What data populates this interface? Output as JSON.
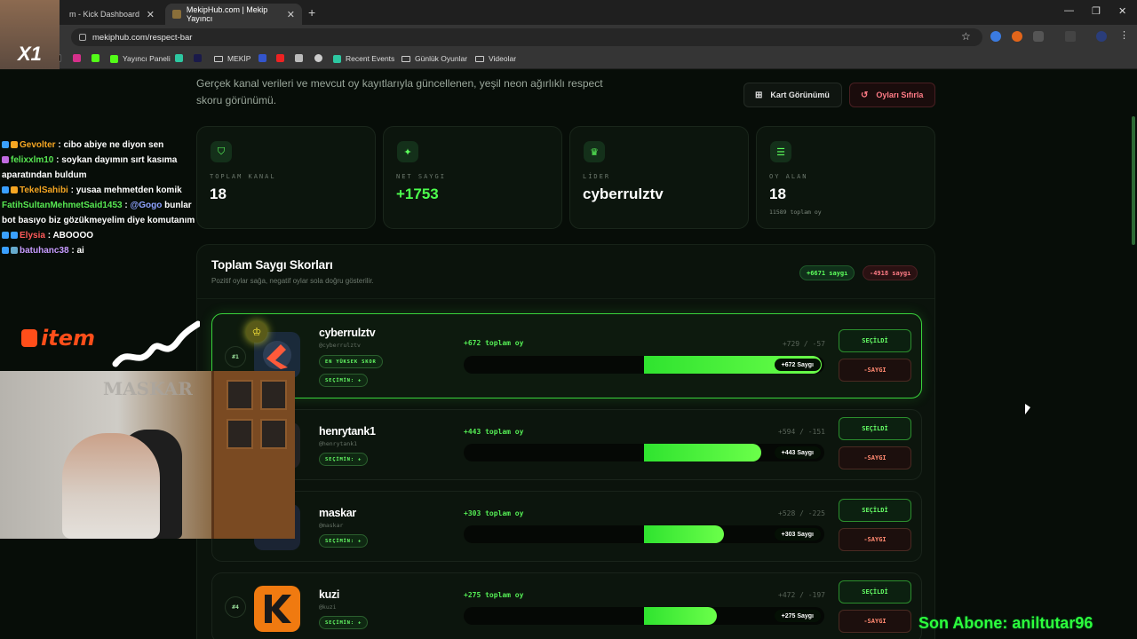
{
  "browser": {
    "tabs": [
      {
        "label": "m - Kick Dashboard"
      },
      {
        "label": "MekipHub.com | Mekip Yayıncı"
      }
    ],
    "url": "mekiphub.com/respect-bar",
    "bookmarks": [
      "Yayıncı Paneli",
      "MEKİP",
      "Recent Events",
      "Günlük Oyunlar",
      "Videolar"
    ]
  },
  "page": {
    "lede": "Gerçek kanal verileri ve mevcut oy kayıtlarıyla güncellenen, yeşil neon ağırlıklı respect skoru görünümü.",
    "card_view_label": "Kart Görünümü",
    "reset_label": "Oyları Sıfırla",
    "stats": [
      {
        "label": "TOPLAM KANAL",
        "value": "18",
        "icon": "shield-icon"
      },
      {
        "label": "NET SAYGI",
        "value": "+1753",
        "icon": "sparkle-icon"
      },
      {
        "label": "LİDER",
        "value": "cyberrulztv",
        "icon": "trophy-icon"
      },
      {
        "label": "OY ALAN",
        "value": "18",
        "sub": "11589 toplam oy",
        "icon": "list-icon"
      }
    ],
    "board": {
      "title": "Toplam Saygı Skorları",
      "subtitle": "Pozitif oylar sağa, negatif oylar sola doğru gösterilir.",
      "positive_chip": "+6671 saygı",
      "negative_chip": "-4918 saygı",
      "rows": [
        {
          "rank": "#1",
          "name": "cyberrulztv",
          "handle": "@cyberrulztv",
          "top_badge": "EN YÜKSEK SKOR",
          "select_badge": "SEÇİMİN: +",
          "total": "+672 toplam oy",
          "split": "+729 / -57",
          "score_label": "+672 Saygı",
          "score": 672,
          "up_label": "SEÇİLDİ",
          "down_label": "-SAYGI"
        },
        {
          "rank": "",
          "name": "henrytank1",
          "handle": "@henrytank1",
          "select_badge": "SEÇİMİN: +",
          "total": "+443 toplam oy",
          "split": "+594 / -151",
          "score_label": "+443 Saygı",
          "score": 443,
          "up_label": "SEÇİLDİ",
          "down_label": "-SAYGI"
        },
        {
          "rank": "",
          "name": "maskar",
          "handle": "@maskar",
          "select_badge": "SEÇİMİN: +",
          "total": "+303 toplam oy",
          "split": "+528 / -225",
          "score_label": "+303 Saygı",
          "score": 303,
          "up_label": "SEÇİLDİ",
          "down_label": "-SAYGI"
        },
        {
          "rank": "#4",
          "name": "kuzi",
          "handle": "@kuzi",
          "select_badge": "SEÇİMİN: +",
          "total": "+275 toplam oy",
          "split": "+472 / -197",
          "score_label": "+275 Saygı",
          "score": 275,
          "up_label": "SEÇİLDİ",
          "down_label": "-SAYGI"
        }
      ]
    }
  },
  "overlay": {
    "chat": [
      {
        "user": "Gevolter",
        "msg": " : cibo abiye ne diyon sen"
      },
      {
        "user": "felixxlm10",
        "msg": " : soykan dayımın sırt kasıma aparatından buldum"
      },
      {
        "user": "TekelSahibi",
        "msg": " : yusaa mehmetden komik"
      },
      {
        "user": "FatihSultanMehmetSaid1453",
        "msg": " : ",
        "mention": "@Gogo",
        "msg2": " bunlar bot basıyo biz gözükmeyelim diye komutanım"
      },
      {
        "user": "Elysia",
        "msg": " : ABOOOO"
      },
      {
        "user": "batuhanc38",
        "msg": " : ai"
      }
    ],
    "sponsor_logo": "item",
    "cam_logo": "X1",
    "wall_text": "MASKAR",
    "last_sub": "Son Abone: aniltutar96"
  }
}
